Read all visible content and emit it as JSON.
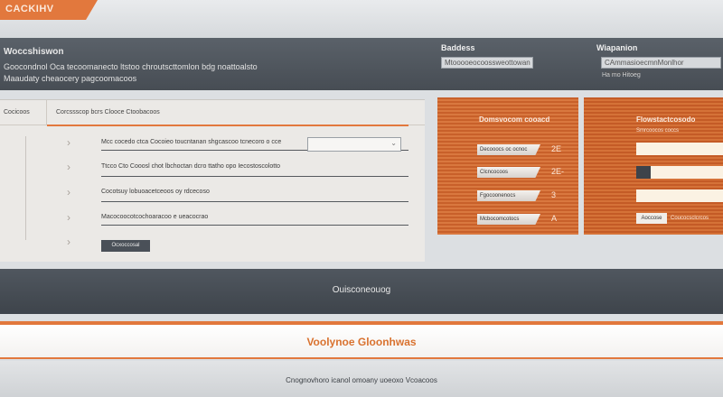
{
  "app": {
    "logo_text": "CACKIHV"
  },
  "header": {
    "title": "Woccshiswon",
    "subtitle_1": "Goocondnol Oca tecoomanecto ltstoo chroutscttomlon bdg noattoalsto",
    "subtitle_2": "Maaudaty cheaocery pagcoomacoos",
    "field_a": {
      "label": "Baddess",
      "value": "Mtooooeocoossweottowan"
    },
    "field_b": {
      "label": "Wiapanion",
      "value": "CAmmasioecmnMonlhor aovcalcotsr",
      "note": "Ha  mo  Hitoeg"
    }
  },
  "form": {
    "tab_primary": "Cocicoos",
    "tab_secondary": "Corcssscop bcrs Clooce Ctoobacoos",
    "rows": [
      {
        "text": "Mcc cocedo ctca Cocoieo toucntanan shgcascoo tcnecoro o  cce"
      },
      {
        "text": "Ttcco Cto Cooosl chot lbchoctan dcro ttatho opo Iecostoscolotto"
      },
      {
        "text": "Cocotsuy lobuoacetceoos oy rdcecoso"
      },
      {
        "text": "Macocoocotcochoaracoo e ueacocrao"
      }
    ],
    "submit_label": "Ocxoccosal"
  },
  "card_1": {
    "title": "Domsvocom cooacd",
    "fields": [
      {
        "label": "Decooocs oc ocnoc",
        "value": "2E"
      },
      {
        "label": "Clcncocoos",
        "value": "2E-"
      },
      {
        "label": "Fgocoonenocs",
        "value": "3"
      },
      {
        "label": "Mcbocomcotocs",
        "value": "A"
      }
    ]
  },
  "card_2": {
    "title": "Flowstactcosodo",
    "caption_1": "Smrcoocos coccs",
    "button_label": "Aoccose",
    "caption_2": "Coucocsclcrcos"
  },
  "section_band": {
    "title": "Ouisconeouog"
  },
  "banner": {
    "title": "Voolynoe Gloonhwas"
  },
  "footer": {
    "text": "Cnognovhoro icanol omoany uoeoxo Vcoacoos"
  }
}
